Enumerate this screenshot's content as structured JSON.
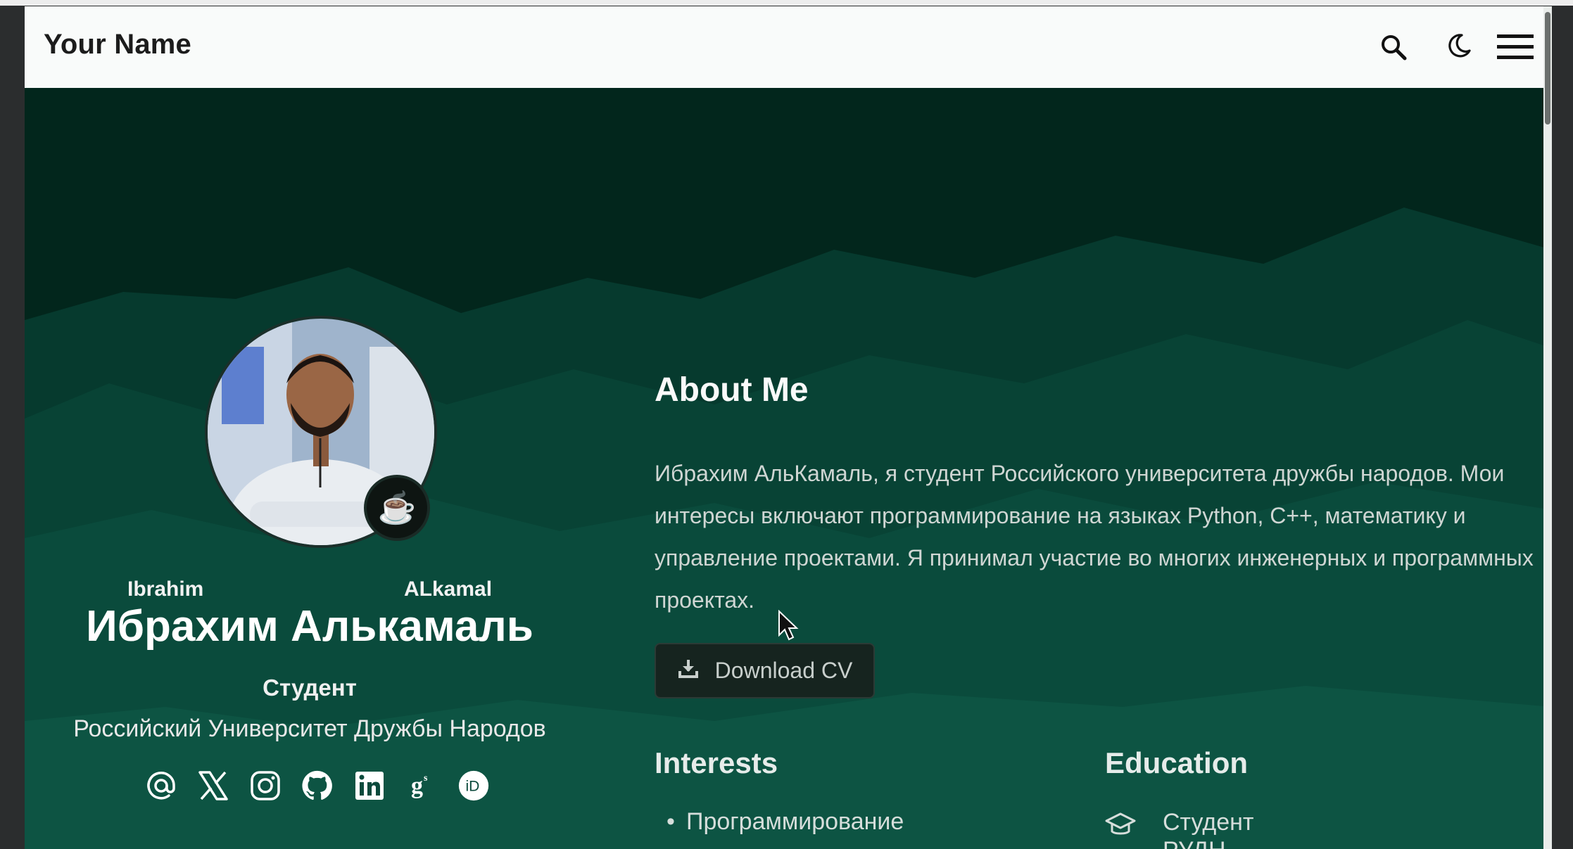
{
  "navbar": {
    "brand": "Your Name",
    "icons": [
      "search-icon",
      "moon-icon",
      "hamburger-menu-icon"
    ]
  },
  "profile": {
    "first_name_en": "Ibrahim",
    "last_name_en": "ALkamal",
    "name_ru": "Ибрахим Алькамаль",
    "role": "Студент",
    "university": "Российский Университет Дружбы Народов",
    "socials": [
      "email-icon",
      "x-twitter-icon",
      "instagram-icon",
      "github-icon",
      "linkedin-icon",
      "google-scholar-icon",
      "orcid-icon"
    ]
  },
  "about": {
    "title": "About Me",
    "text": "Ибрахим АльКамаль, я студент Российского университета дружбы народов. Мои интересы включают программирование на языках Python, C++, математику и управление проектами. Я принимал участие во многих инженерных и программных проектах.",
    "download_label": "Download CV"
  },
  "interests": {
    "title": "Interests",
    "items": [
      "Программирование"
    ]
  },
  "education": {
    "title": "Education",
    "items": [
      {
        "line1": "Студент",
        "line2": "РУДН"
      }
    ]
  },
  "colors": {
    "hero_bg": "#02261c",
    "mountain": "#0b4a3c",
    "navbar_bg": "#f9fbfa"
  }
}
